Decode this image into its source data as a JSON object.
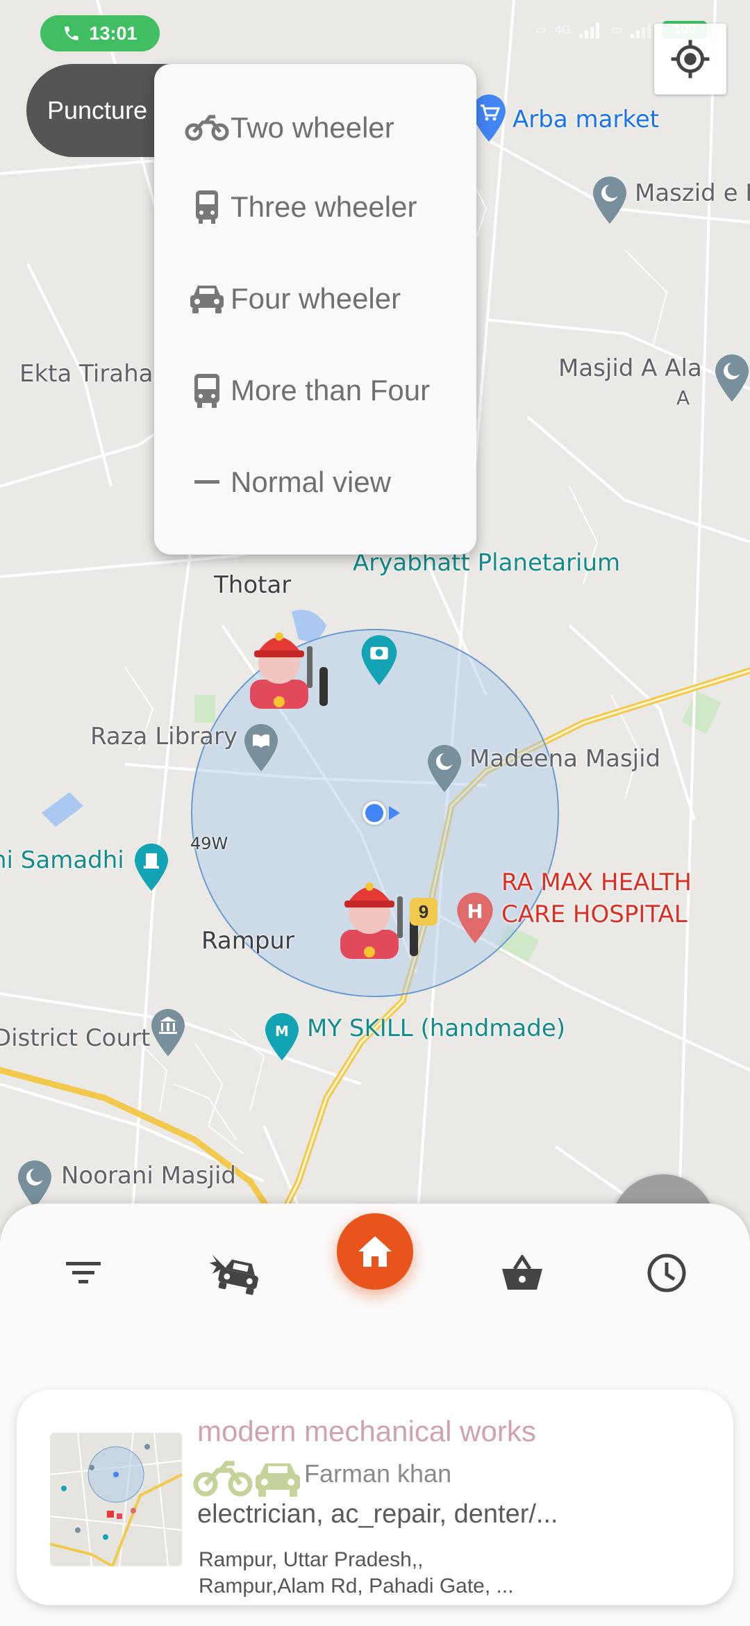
{
  "status_bar": {
    "time": "13:01",
    "battery": "100",
    "network_1": "4G",
    "signal_icon": "signal-icon",
    "call_icon": "phone-icon"
  },
  "location_button": {
    "icon": "my-location-icon"
  },
  "puncture_button": {
    "label": "Puncture"
  },
  "vehicle_menu": {
    "items": [
      {
        "label": "Two wheeler",
        "icon": "motorcycle-icon"
      },
      {
        "label": "Three wheeler",
        "icon": "tram-icon"
      },
      {
        "label": "Four wheeler",
        "icon": "car-icon"
      },
      {
        "label": "More than Four",
        "icon": "bus-icon"
      },
      {
        "label": "Normal view",
        "icon": "dash-icon"
      }
    ]
  },
  "map": {
    "places": {
      "arba_market": "Arba market",
      "maszid": "Maszid e I",
      "ekta_tiraha": "Ekta Tiraha",
      "masjid_a_ala": "Masjid A Ala",
      "masjid_a_ala_sub": "A",
      "aryabhatt": "Aryabhatt Planetarium",
      "thotar": "Thotar",
      "raza_library": "Raza Library",
      "madeena": "Madeena Masjid",
      "samadhi": "hi Samadhi",
      "road_49w": "49W",
      "ra_max_1": "RA MAX HEALTH",
      "ra_max_2": "CARE HOSPITAL",
      "rampur": "Rampur",
      "district_court": "District Court",
      "my_skill": "MY SKILL (handmade)",
      "noorani": "Noorani Masjid"
    }
  },
  "bottom_nav": {
    "items": [
      {
        "name": "filter",
        "icon": "filter-icon"
      },
      {
        "name": "accident",
        "icon": "car-crash-icon"
      },
      {
        "name": "home",
        "icon": "home-icon"
      },
      {
        "name": "basket",
        "icon": "basket-icon"
      },
      {
        "name": "history",
        "icon": "clock-icon"
      }
    ],
    "accent": "#e8541c"
  },
  "shop_card": {
    "name": "modern mechanical works",
    "owner": "Farman khan",
    "services": "electrician, ac_repair, denter/...",
    "address_line_1": "Rampur, Uttar Pradesh,,",
    "address_line_2": "Rampur,Alam Rd, Pahadi Gate, ..."
  }
}
